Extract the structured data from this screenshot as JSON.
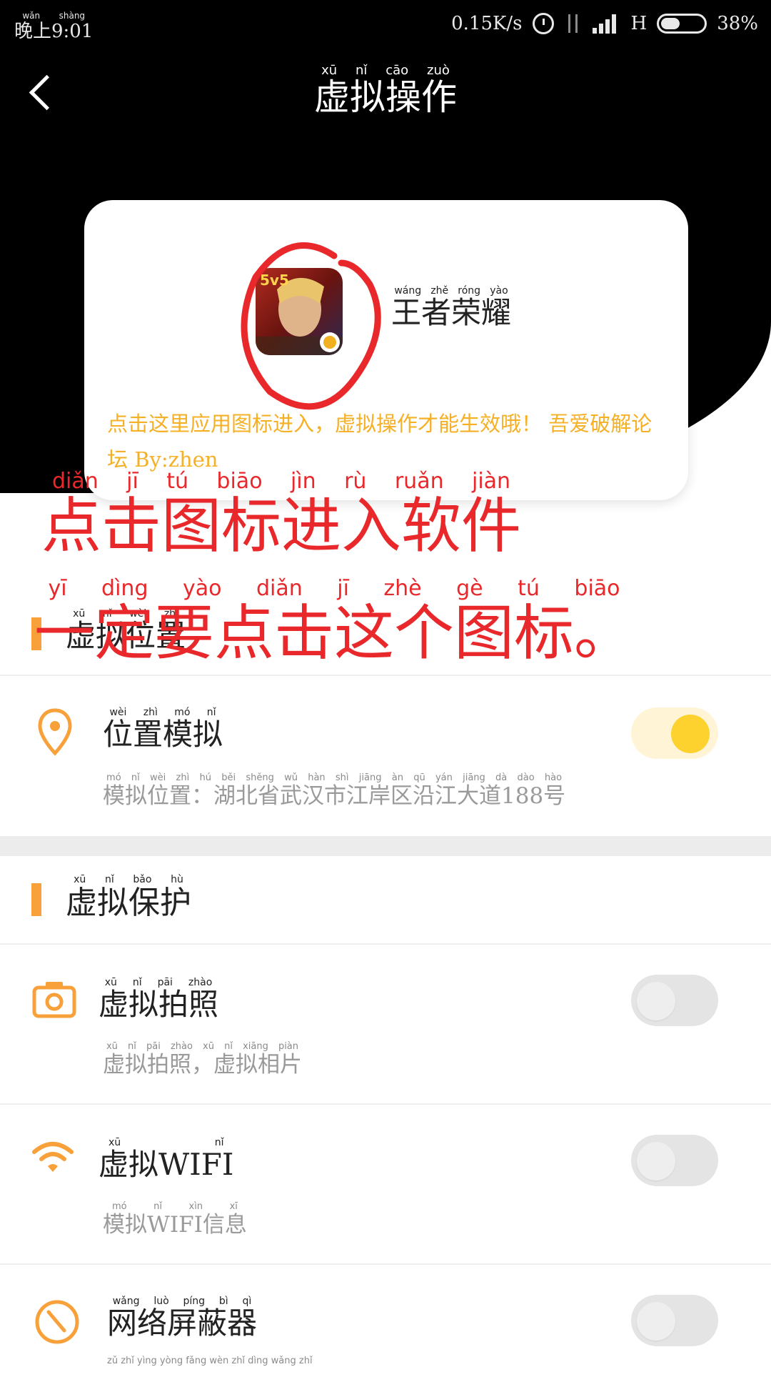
{
  "status_bar": {
    "time": "晚上9:01",
    "time_ruby": "wǎn shàng",
    "speed": "0.15K/s",
    "network": "H",
    "battery": "38%"
  },
  "header": {
    "title": "虚拟操作",
    "title_ruby": "xū   nǐ   cāo  zuò"
  },
  "app_card": {
    "app_name": "王者荣耀",
    "app_name_ruby": "wáng zhě róng yào",
    "icon_badge": "5v5",
    "note": "点击这里应用图标进入，虚拟操作才能生效哦！ 吾爱破解论坛 By:zhen"
  },
  "annotations": {
    "line1": "点击图标进入软件",
    "line1_ruby": "diǎn   jī   tú   biāo   jìn   rù   ruǎn   jiàn",
    "line2": "一定要点击这个图标。",
    "line2_ruby": "yī   dìng   yào   diǎn   jī   zhè   gè   tú   biāo"
  },
  "sections": {
    "location": {
      "title": "虚拟位置",
      "title_ruby": "xū nǐ wèi zhì",
      "item_title": "位置模拟",
      "item_title_ruby": "wèi  zhì  mó  nǐ",
      "item_sub": "模拟位置：湖北省武汉市江岸区沿江大道188号",
      "item_sub_ruby": "mó nǐ wèi zhì    hú běi shěng wǔ hàn shì jiāng àn qū yán jiāng dà dào   hào",
      "toggle": "on"
    },
    "protect": {
      "title": "虚拟保护",
      "title_ruby": "xū  nǐ  bǎo  hù",
      "items": [
        {
          "title": "虚拟拍照",
          "title_ruby": "xū  nǐ  pāi  zhào",
          "sub": "虚拟拍照，虚拟相片",
          "sub_ruby": "xū nǐ pāi zhào   xū nǐ xiāng piàn",
          "toggle": "off"
        },
        {
          "title": "虚拟WIFI",
          "title_ruby": "xū  nǐ",
          "sub": "模拟WIFI信息",
          "sub_ruby": "mó nǐ         xìn xī",
          "toggle": "off"
        },
        {
          "title": "网络屏蔽器",
          "title_ruby": "wǎng luò píng bì qì",
          "sub": "",
          "sub_ruby": "zǔ zhǐ yìng yòng fǎng wèn zhǐ dìng wǎng zhǐ",
          "toggle": "off"
        }
      ]
    }
  },
  "colors": {
    "accent_orange": "#f8a039",
    "toggle_on": "#fdd22e",
    "annotation_red": "#e8282a",
    "note_yellow": "#f5b026"
  }
}
